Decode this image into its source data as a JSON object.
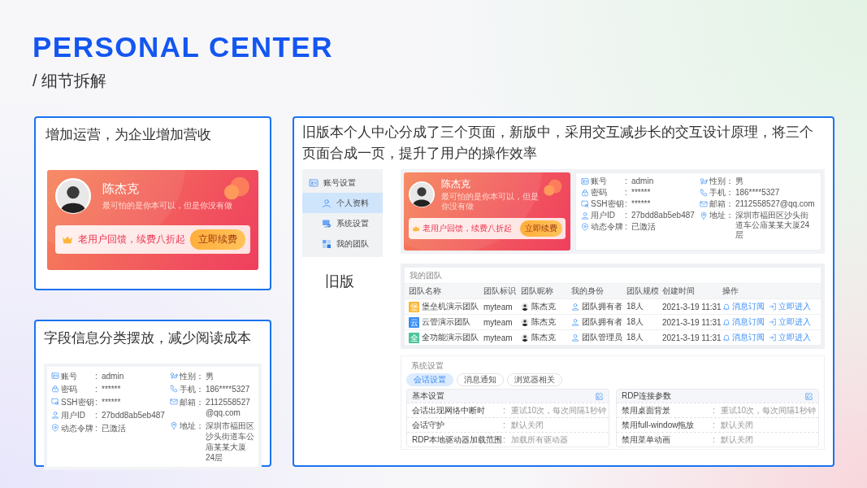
{
  "title": "PERSONAL CENTER",
  "subtitle": "/ 细节拆解",
  "promo_panel": {
    "caption": "增加运营，为企业增加营收",
    "profile_card": {
      "name": "陈杰克",
      "motto": "最可怕的是你本可以，但是你没有做",
      "promo": "老用户回馈，续费八折起",
      "button": "立即续费"
    }
  },
  "fields_panel": {
    "caption": "字段信息分类摆放，减少阅读成本",
    "fields": [
      [
        {
          "kind": "account",
          "label": "账号",
          "sep": ":",
          "value": "admin"
        },
        {
          "kind": "password",
          "label": "密码",
          "sep": ":",
          "value": "******"
        },
        {
          "kind": "ssh",
          "label": "SSH密钥",
          "sep": ":",
          "value": "******"
        },
        {
          "kind": "user_id",
          "label": "用户ID",
          "sep": ":",
          "value": "27bdd8ab5eb487"
        },
        {
          "kind": "token",
          "label": "动态令牌",
          "sep": ":",
          "value": "已激活"
        }
      ],
      [
        {
          "kind": "gender",
          "label": "性别：",
          "value": "男"
        },
        {
          "kind": "phone",
          "label": "手机：",
          "value": "186****5327"
        },
        {
          "kind": "email",
          "label": "邮箱：",
          "value": "2112558527@qq.com"
        },
        {
          "kind": "address",
          "label": "地址：",
          "value": "深圳市福田区沙头街道车公庙某某大厦24层"
        }
      ]
    ]
  },
  "redesign_panel": {
    "caption": "旧版本个人中心分成了三个页面，新版中，采用交互减步长的交互设计原理，将三个页面合成一页，提升了用户的操作效率",
    "sidebar": {
      "header": "账号设置",
      "items": [
        {
          "kind": "profile",
          "label": "个人资料",
          "selected": true
        },
        {
          "kind": "system",
          "label": "系统设置",
          "selected": false
        },
        {
          "kind": "team",
          "label": "我的团队",
          "selected": false
        }
      ]
    },
    "version_label": "旧版",
    "profile_card": {
      "name": "陈杰克",
      "motto": "最可怕的是你本可以，但是你没有做",
      "promo": "老用户回馈，续费八折起",
      "button": "立即续费"
    },
    "fields": [
      [
        {
          "kind": "account",
          "label": "账号",
          "sep": ":",
          "value": "admin"
        },
        {
          "kind": "password",
          "label": "密码",
          "sep": ":",
          "value": "******"
        },
        {
          "kind": "ssh",
          "label": "SSH密钥",
          "sep": ":",
          "value": "******"
        },
        {
          "kind": "user_id",
          "label": "用户ID",
          "sep": ":",
          "value": "27bdd8ab5eb487"
        },
        {
          "kind": "token",
          "label": "动态令牌",
          "sep": ":",
          "value": "已激活"
        }
      ],
      [
        {
          "kind": "gender",
          "label": "性别：",
          "value": "男"
        },
        {
          "kind": "phone",
          "label": "手机：",
          "value": "186****5327"
        },
        {
          "kind": "email",
          "label": "邮箱：",
          "value": "2112558527@qq.com"
        },
        {
          "kind": "address",
          "label": "地址：",
          "value": "深圳市福田区沙头街道车公庙某某大厦24层"
        }
      ]
    ],
    "team_table": {
      "title": "我的团队",
      "columns": [
        "团队名称",
        "团队标识",
        "团队昵称",
        "我的身份",
        "团队规模",
        "创建时间",
        "操作"
      ],
      "rows": [
        {
          "badge": "堡",
          "color": "#fbb631",
          "name": "堡垒机演示团队",
          "tag": "myteam",
          "nickname": "陈杰克",
          "role": "团队拥有者",
          "size": "18人",
          "created": "2021-3-19 11:31",
          "actions": [
            "消息订阅",
            "立即进入"
          ]
        },
        {
          "badge": "云",
          "color": "#3a8ef6",
          "name": "云管演示团队",
          "tag": "myteam",
          "nickname": "陈杰克",
          "role": "团队拥有者",
          "size": "18人",
          "created": "2021-3-19 11:31",
          "actions": [
            "消息订阅",
            "立即进入"
          ]
        },
        {
          "badge": "全",
          "color": "#4cc59a",
          "name": "全功能演示团队",
          "tag": "myteam",
          "nickname": "陈杰克",
          "role": "团队管理员",
          "size": "18人",
          "created": "2021-3-19 11:31",
          "actions": [
            "消息订阅",
            "立即进入"
          ]
        }
      ]
    },
    "settings": {
      "title": "系统设置",
      "tabs": [
        {
          "label": "会话设置",
          "selected": true
        },
        {
          "label": "消息通知",
          "selected": false
        },
        {
          "label": "浏览器相关",
          "selected": false
        }
      ],
      "groups": [
        {
          "title": "基本设置",
          "rows": [
            {
              "label": "会话出现网络中断时",
              "sep": ":",
              "value": "重试10次，每次间隔1秒钟"
            },
            {
              "label": "会话守护",
              "sep": ":",
              "value": "默认关闭"
            },
            {
              "label": "RDP本地驱动器加载范围",
              "sep": ":",
              "value": "加载所有驱动器"
            }
          ]
        },
        {
          "title": "RDP连接参数",
          "rows": [
            {
              "label": "禁用桌面背景",
              "sep": ":",
              "value": "重试10次，每次间隔1秒钟"
            },
            {
              "label": "禁用full-window拖放",
              "sep": ":",
              "value": "默认关闭"
            },
            {
              "label": "禁用菜单动画",
              "sep": ":",
              "value": "默认关闭"
            }
          ]
        }
      ]
    }
  }
}
